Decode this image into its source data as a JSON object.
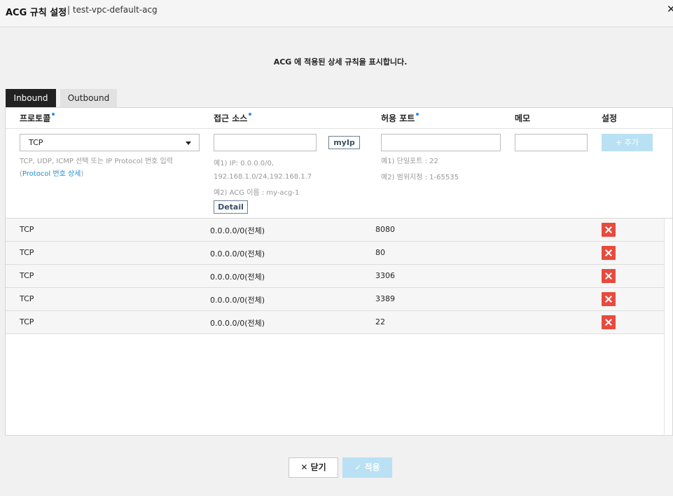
{
  "header": {
    "title": "ACG 규칙 설정",
    "subtitle": "| test-vpc-default-acg",
    "close_icon": "✕"
  },
  "description": "ACG 에 적용된 상세 규칙을 표시합니다.",
  "tabs": [
    {
      "label": "Inbound",
      "active": true
    },
    {
      "label": "Outbound",
      "active": false
    }
  ],
  "columns": {
    "protocol": "프로토콜",
    "source": "접근 소스",
    "port": "허용 포트",
    "memo": "메모",
    "settings": "설정"
  },
  "form": {
    "protocol_value": "TCP",
    "protocol_hint": "TCP, UDP, ICMP 선택 또는 IP Protocol 번호 입력",
    "protocol_link_open": "(",
    "protocol_link": "Protocol 번호 상세",
    "protocol_link_close": ")",
    "source_value": "",
    "myip_label": "myIp",
    "source_hint_1": "예1) IP: 0.0.0.0/0,",
    "source_hint_2": "192.168.1.0/24,192.168.1.7",
    "source_hint_3": "예2) ACG 이름 : my-acg-1",
    "detail_label": "Detail",
    "port_value": "",
    "port_hint_1": "예1) 단일포트 : 22",
    "port_hint_2": "예2) 범위지정 : 1-65535",
    "memo_value": "",
    "add_label": "+ 추가"
  },
  "rules": [
    {
      "protocol": "TCP",
      "source": "0.0.0.0/0(전체)",
      "port": "8080"
    },
    {
      "protocol": "TCP",
      "source": "0.0.0.0/0(전체)",
      "port": "80"
    },
    {
      "protocol": "TCP",
      "source": "0.0.0.0/0(전체)",
      "port": "3306"
    },
    {
      "protocol": "TCP",
      "source": "0.0.0.0/0(전체)",
      "port": "3389"
    },
    {
      "protocol": "TCP",
      "source": "0.0.0.0/0(전체)",
      "port": "22"
    }
  ],
  "footer": {
    "close_label": "✕ 닫기",
    "apply_label": "✓ 적용"
  },
  "colors": {
    "accent": "#2b8fe6",
    "delete": "#e84a3e",
    "disabled_button": "#b9e1f3"
  }
}
